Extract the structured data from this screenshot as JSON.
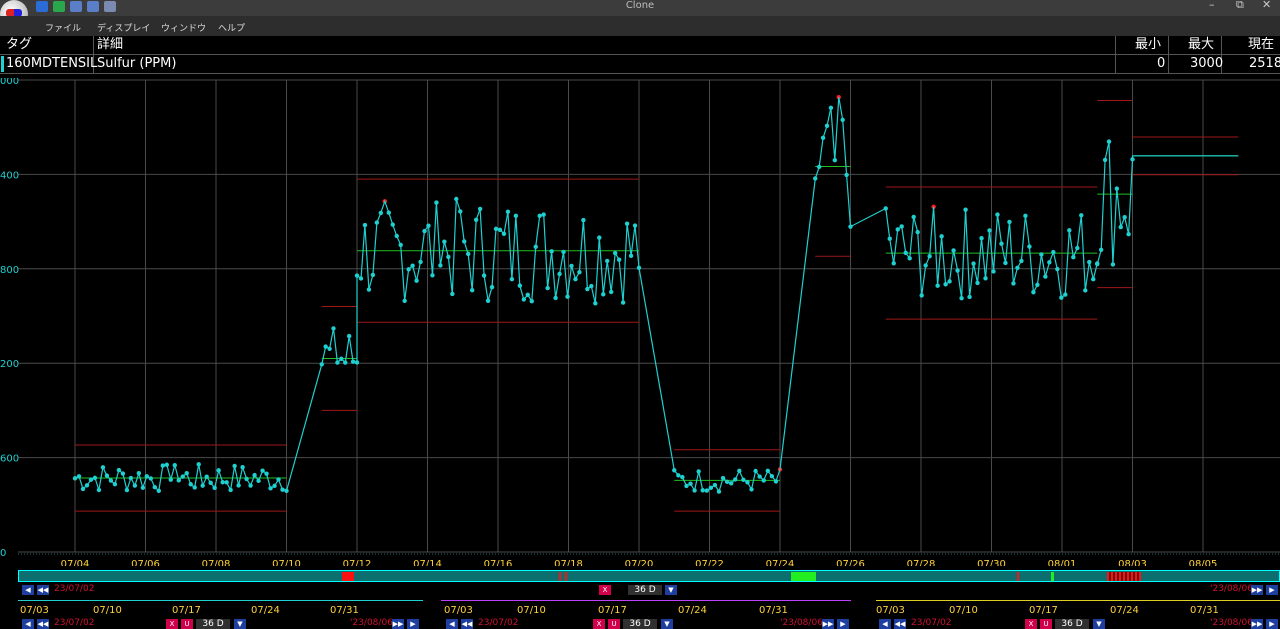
{
  "window": {
    "title": "Clone"
  },
  "menu": {
    "items": [
      "ファイル",
      "ディスプレイ",
      "ウィンドウ",
      "ヘルプ"
    ]
  },
  "tag_table": {
    "headers": {
      "tag": "タグ",
      "detail": "詳細",
      "min": "最小",
      "max": "最大",
      "current": "現在"
    },
    "row": {
      "tag": "160MDTENSIL",
      "detail": "Sulfur (PPM)",
      "min": "0",
      "max": "3000",
      "current": "2518"
    }
  },
  "chart_data": {
    "type": "line",
    "ylim": [
      0,
      3000
    ],
    "y_tick_labels": [
      "000",
      "400",
      "800",
      "200",
      "600",
      "0"
    ],
    "x_tick_labels": [
      "07/04",
      "07/06",
      "07/08",
      "07/10",
      "07/12",
      "07/14",
      "07/16",
      "07/18",
      "07/20",
      "07/22",
      "07/24",
      "07/26",
      "07/28",
      "07/30",
      "08/01",
      "08/03",
      "08/05"
    ],
    "series": [
      {
        "segments": [
          {
            "from": "07/04",
            "to": "07/10",
            "level_range": [
              380,
              560
            ]
          },
          {
            "from": "07/11",
            "to": "07/12",
            "level_range": [
              1020,
              1440
            ]
          },
          {
            "from": "07/12",
            "to": "07/20",
            "level_range": [
              1580,
              2250
            ]
          },
          {
            "from": "07/21",
            "to": "07/24",
            "level_range": [
              380,
              530
            ]
          },
          {
            "from": "07/25",
            "to": "07/26",
            "level_range": [
              2000,
              2900
            ]
          },
          {
            "from": "07/27",
            "to": "08/02",
            "level_range": [
              1600,
              2200
            ]
          },
          {
            "from": "08/02",
            "to": "08/03",
            "level_range": [
              1800,
              2750
            ]
          },
          {
            "from": "08/03",
            "to": "08/06",
            "level_range": [
              2518,
              2518
            ]
          }
        ]
      }
    ],
    "annotations": {
      "bands": "red high/low limits and green average line per segment"
    },
    "grid": true,
    "colors": {
      "line": "#1fd0d0",
      "alarm": "#ff2020",
      "limit": "#a01818",
      "average": "#20c020",
      "grid": "#4a4a4a",
      "background": "#000000"
    }
  },
  "trend_nav": {
    "start": "23/07/02",
    "end": "'23/08/06",
    "duration": "36 D",
    "strip_ticks": [
      "07/03",
      "07/10",
      "07/17",
      "07/24",
      "07/31"
    ],
    "buttons": {
      "prev": "◀",
      "first": "◀◀",
      "next": "▶",
      "last": "▶▶",
      "x": "X",
      "u": "U",
      "drop": "▼"
    }
  }
}
